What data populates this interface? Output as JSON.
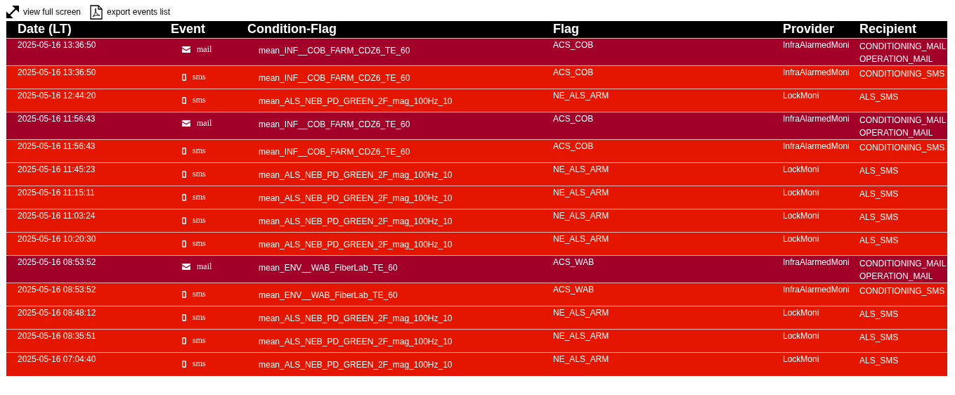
{
  "toolbar": [
    {
      "kind": "fullscreen",
      "label": "view full screen"
    },
    {
      "kind": "pdf",
      "label": "export events list"
    }
  ],
  "table": {
    "columns": [
      "Date (LT)",
      "Event",
      "Condition-Flag",
      "Flag",
      "Provider",
      "Recipient"
    ],
    "rows": [
      {
        "date": "2025-05-16 13:36:50",
        "event": {
          "kind": "mail",
          "label": "mail"
        },
        "condition": "mean_INF__COB_FARM_CDZ6_TE_60",
        "flag": "ACS_COB",
        "provider": "InfraAlarmedMoni",
        "recipients": [
          "CONDITIONING_MAIL",
          "OPERATION_MAIL"
        ]
      },
      {
        "date": "2025-05-16 13:36:50",
        "event": {
          "kind": "sms",
          "label": "sms"
        },
        "condition": "mean_INF__COB_FARM_CDZ6_TE_60",
        "flag": "ACS_COB",
        "provider": "InfraAlarmedMoni",
        "recipients": [
          "CONDITIONING_SMS"
        ]
      },
      {
        "date": "2025-05-16 12:44:20",
        "event": {
          "kind": "sms",
          "label": "sms"
        },
        "condition": "mean_ALS_NEB_PD_GREEN_2F_mag_100Hz_10",
        "flag": "NE_ALS_ARM",
        "provider": "LockMoni",
        "recipients": [
          "ALS_SMS"
        ]
      },
      {
        "date": "2025-05-16 11:56:43",
        "event": {
          "kind": "mail",
          "label": "mail"
        },
        "condition": "mean_INF__COB_FARM_CDZ6_TE_60",
        "flag": "ACS_COB",
        "provider": "InfraAlarmedMoni",
        "recipients": [
          "CONDITIONING_MAIL",
          "OPERATION_MAIL"
        ]
      },
      {
        "date": "2025-05-16 11:56:43",
        "event": {
          "kind": "sms",
          "label": "sms"
        },
        "condition": "mean_INF__COB_FARM_CDZ6_TE_60",
        "flag": "ACS_COB",
        "provider": "InfraAlarmedMoni",
        "recipients": [
          "CONDITIONING_SMS"
        ]
      },
      {
        "date": "2025-05-16 11:45:23",
        "event": {
          "kind": "sms",
          "label": "sms"
        },
        "condition": "mean_ALS_NEB_PD_GREEN_2F_mag_100Hz_10",
        "flag": "NE_ALS_ARM",
        "provider": "LockMoni",
        "recipients": [
          "ALS_SMS"
        ]
      },
      {
        "date": "2025-05-16 11:15:11",
        "event": {
          "kind": "sms",
          "label": "sms"
        },
        "condition": "mean_ALS_NEB_PD_GREEN_2F_mag_100Hz_10",
        "flag": "NE_ALS_ARM",
        "provider": "LockMoni",
        "recipients": [
          "ALS_SMS"
        ]
      },
      {
        "date": "2025-05-16 11:03:24",
        "event": {
          "kind": "sms",
          "label": "sms"
        },
        "condition": "mean_ALS_NEB_PD_GREEN_2F_mag_100Hz_10",
        "flag": "NE_ALS_ARM",
        "provider": "LockMoni",
        "recipients": [
          "ALS_SMS"
        ]
      },
      {
        "date": "2025-05-16 10:20:30",
        "event": {
          "kind": "sms",
          "label": "sms"
        },
        "condition": "mean_ALS_NEB_PD_GREEN_2F_mag_100Hz_10",
        "flag": "NE_ALS_ARM",
        "provider": "LockMoni",
        "recipients": [
          "ALS_SMS"
        ]
      },
      {
        "date": "2025-05-16 08:53:52",
        "event": {
          "kind": "mail",
          "label": "mail"
        },
        "condition": "mean_ENV__WAB_FiberLab_TE_60",
        "flag": "ACS_WAB",
        "provider": "InfraAlarmedMoni",
        "recipients": [
          "CONDITIONING_MAIL",
          "OPERATION_MAIL"
        ]
      },
      {
        "date": "2025-05-16 08:53:52",
        "event": {
          "kind": "sms",
          "label": "sms"
        },
        "condition": "mean_ENV__WAB_FiberLab_TE_60",
        "flag": "ACS_WAB",
        "provider": "InfraAlarmedMoni",
        "recipients": [
          "CONDITIONING_SMS"
        ]
      },
      {
        "date": "2025-05-16 08:48:12",
        "event": {
          "kind": "sms",
          "label": "sms"
        },
        "condition": "mean_ALS_NEB_PD_GREEN_2F_mag_100Hz_10",
        "flag": "NE_ALS_ARM",
        "provider": "LockMoni",
        "recipients": [
          "ALS_SMS"
        ]
      },
      {
        "date": "2025-05-16 08:35:51",
        "event": {
          "kind": "sms",
          "label": "sms"
        },
        "condition": "mean_ALS_NEB_PD_GREEN_2F_mag_100Hz_10",
        "flag": "NE_ALS_ARM",
        "provider": "LockMoni",
        "recipients": [
          "ALS_SMS"
        ]
      },
      {
        "date": "2025-05-16 07:04:40",
        "event": {
          "kind": "sms",
          "label": "sms"
        },
        "condition": "mean_ALS_NEB_PD_GREEN_2F_mag_100Hz_10",
        "flag": "NE_ALS_ARM",
        "provider": "LockMoni",
        "recipients": [
          "ALS_SMS"
        ]
      }
    ]
  }
}
